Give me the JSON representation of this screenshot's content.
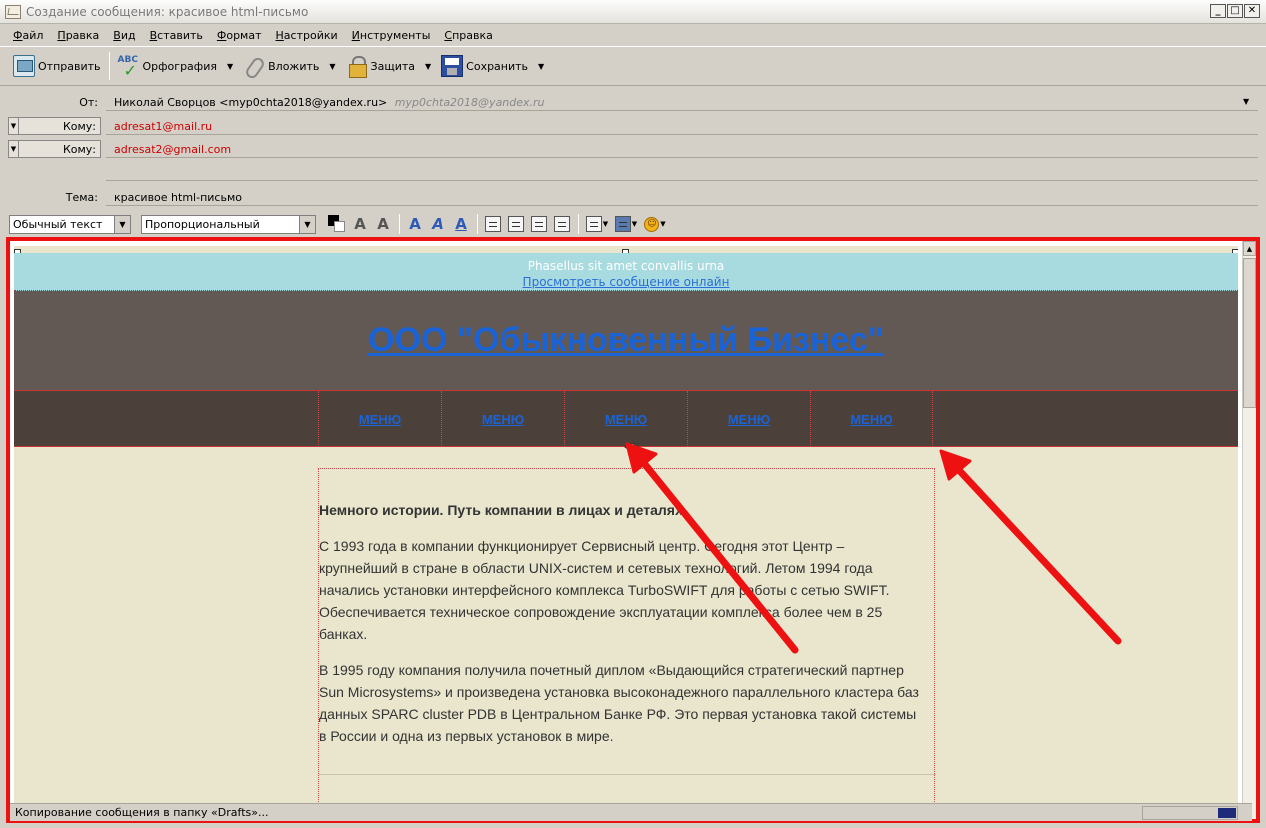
{
  "window": {
    "title": "Создание сообщения: красивое html-письмо"
  },
  "menu": [
    "Файл",
    "Правка",
    "Вид",
    "Вставить",
    "Формат",
    "Настройки",
    "Инструменты",
    "Справка"
  ],
  "toolbar": {
    "send": "Отправить",
    "spelling": "Орфография",
    "attach": "Вложить",
    "security": "Защита",
    "save": "Сохранить"
  },
  "header": {
    "from_label": "От:",
    "from_value": "Николай Сворцов <myp0chta2018@yandex.ru>",
    "from_hint": "myp0chta2018@yandex.ru",
    "to_label": "Кому:",
    "recipients": [
      "adresat1@mail.ru",
      "adresat2@gmail.com"
    ],
    "subject_label": "Тема:",
    "subject_value": "красивое html-письмо"
  },
  "format": {
    "paragraph_style": "Обычный текст",
    "font": "Пропорциональный"
  },
  "email": {
    "preheader": "Phasellus sit amet convallis urna",
    "view_online": "Просмотреть сообщение онлайн",
    "company": "ООО \"Обыкновенный Бизнес\"",
    "menu_items": [
      "МЕНЮ",
      "МЕНЮ",
      "МЕНЮ",
      "МЕНЮ",
      "МЕНЮ"
    ],
    "heading": "Немного истории. Путь компании в лицах и деталях.",
    "paragraph1": "С 1993 года в компании функционирует Сервисный центр. Сегодня этот Центр – крупнейший в стране в области UNIX-систем и сетевых технологий. Летом 1994 года начались установки интерфейсного комплекса TurboSWIFT для работы с сетью SWIFT. Обеспечивается техническое сопровождение эксплуатации комплекса более чем в 25 банках.",
    "paragraph2": "В 1995 году компания получила почетный диплом «Выдающийся стратегический партнер Sun Microsystems» и произведена установка высоконадежного параллельного кластера баз данных SPARC cluster PDB в Центральном Банке РФ. Это первая установка такой системы в России и одна из первых установок в мире."
  },
  "status": {
    "text": "Копирование сообщения в папку «Drafts»..."
  },
  "colors": {
    "annotation_red": "#ee1111",
    "link_blue": "#1a63d6",
    "header_bg": "#635954",
    "nav_bg": "#4b403a",
    "preheader_bg": "#a8dbe0",
    "body_bg": "#e9e6cd"
  }
}
